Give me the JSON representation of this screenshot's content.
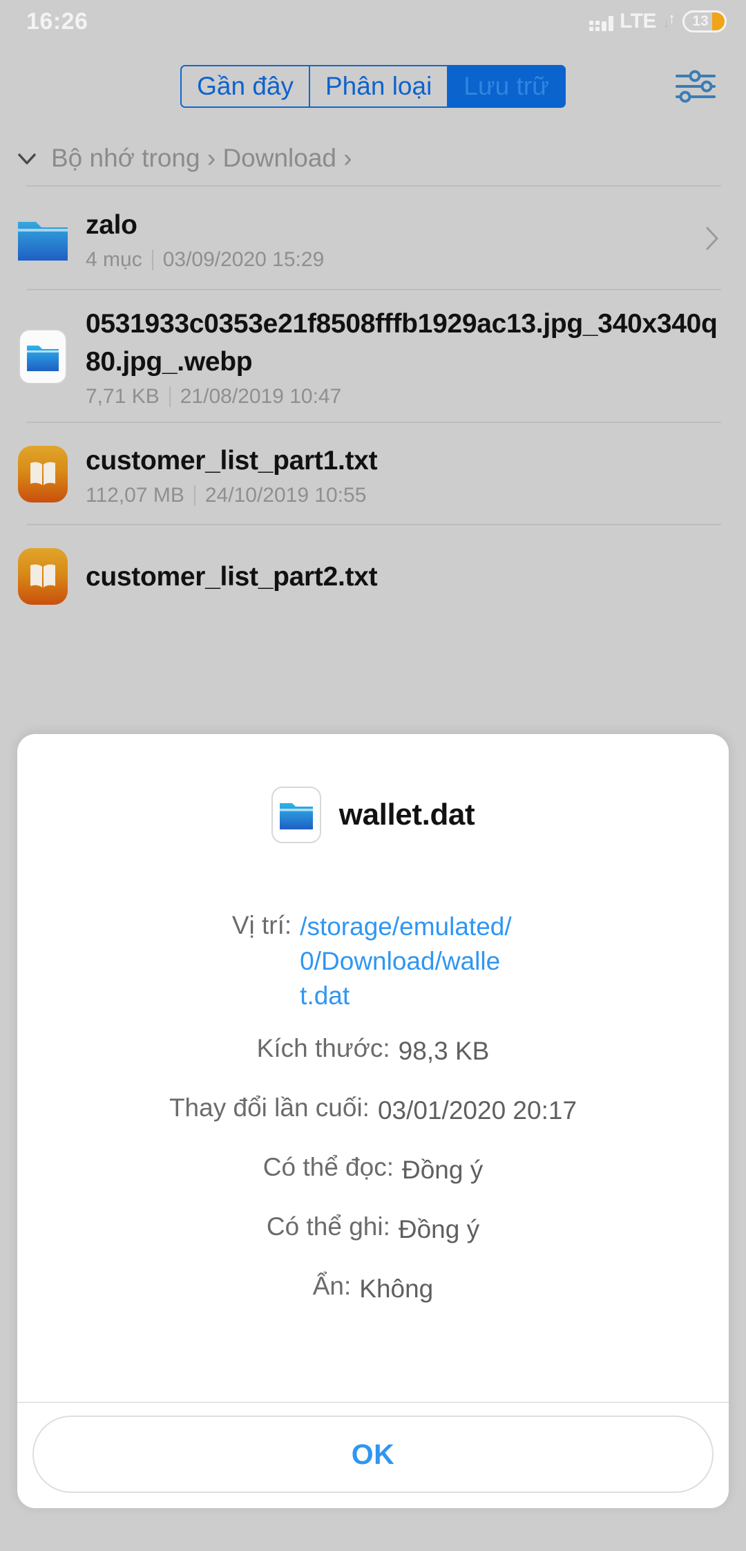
{
  "status_bar": {
    "clock": "16:26",
    "network_label": "LTE",
    "battery_level": "13",
    "signal_icon": "signal-bars-icon",
    "battery_icon": "battery-icon",
    "data_arrows_icon": "data-transfer-arrows-icon",
    "accent_battery_color": "#f0a417"
  },
  "top_bar": {
    "segments": [
      {
        "label": "Gần đây",
        "active": false
      },
      {
        "label": "Phân loại",
        "active": false
      },
      {
        "label": "Lưu trữ",
        "active": true
      }
    ],
    "filter_icon": "sliders-filter-icon",
    "accent_color": "#0b63ce"
  },
  "breadcrumb": {
    "chevron_icon": "chevron-down-icon",
    "path": "Bộ nhớ trong › Download ›"
  },
  "file_list": [
    {
      "name": "zalo",
      "meta_primary": "4 mục",
      "meta_secondary": "03/09/2020 15:29",
      "icon": "folder-icon",
      "has_chevron": true
    },
    {
      "name": "0531933c0353e21f8508fffb1929ac13.jpg_340x340q80.jpg_.webp",
      "meta_primary": "7,71 KB",
      "meta_secondary": "21/08/2019 10:47",
      "icon": "file-folder-card-icon",
      "has_chevron": false
    },
    {
      "name": "customer_list_part1.txt",
      "meta_primary": "112,07 MB",
      "meta_secondary": "24/10/2019 10:55",
      "icon": "book-text-icon",
      "has_chevron": false
    },
    {
      "name": "customer_list_part2.txt",
      "meta_primary": "",
      "meta_secondary": "",
      "icon": "book-text-icon",
      "has_chevron": false
    }
  ],
  "dialog": {
    "title": "wallet.dat",
    "file_icon": "file-folder-card-icon",
    "details": [
      {
        "label": "Vị trí:",
        "value": "/storage/emulated/0/Download/wallet.dat",
        "is_link": true
      },
      {
        "label": "Kích thước:",
        "value": "98,3 KB",
        "is_link": false
      },
      {
        "label": "Thay đổi lần cuối:",
        "value": "03/01/2020 20:17",
        "is_link": false
      },
      {
        "label": "Có thể đọc:",
        "value": "Đồng ý",
        "is_link": false
      },
      {
        "label": "Có thể ghi:",
        "value": "Đồng ý",
        "is_link": false
      },
      {
        "label": "Ẩn:",
        "value": "Không",
        "is_link": false
      }
    ],
    "ok_label": "OK",
    "link_color": "#2f96f2"
  }
}
